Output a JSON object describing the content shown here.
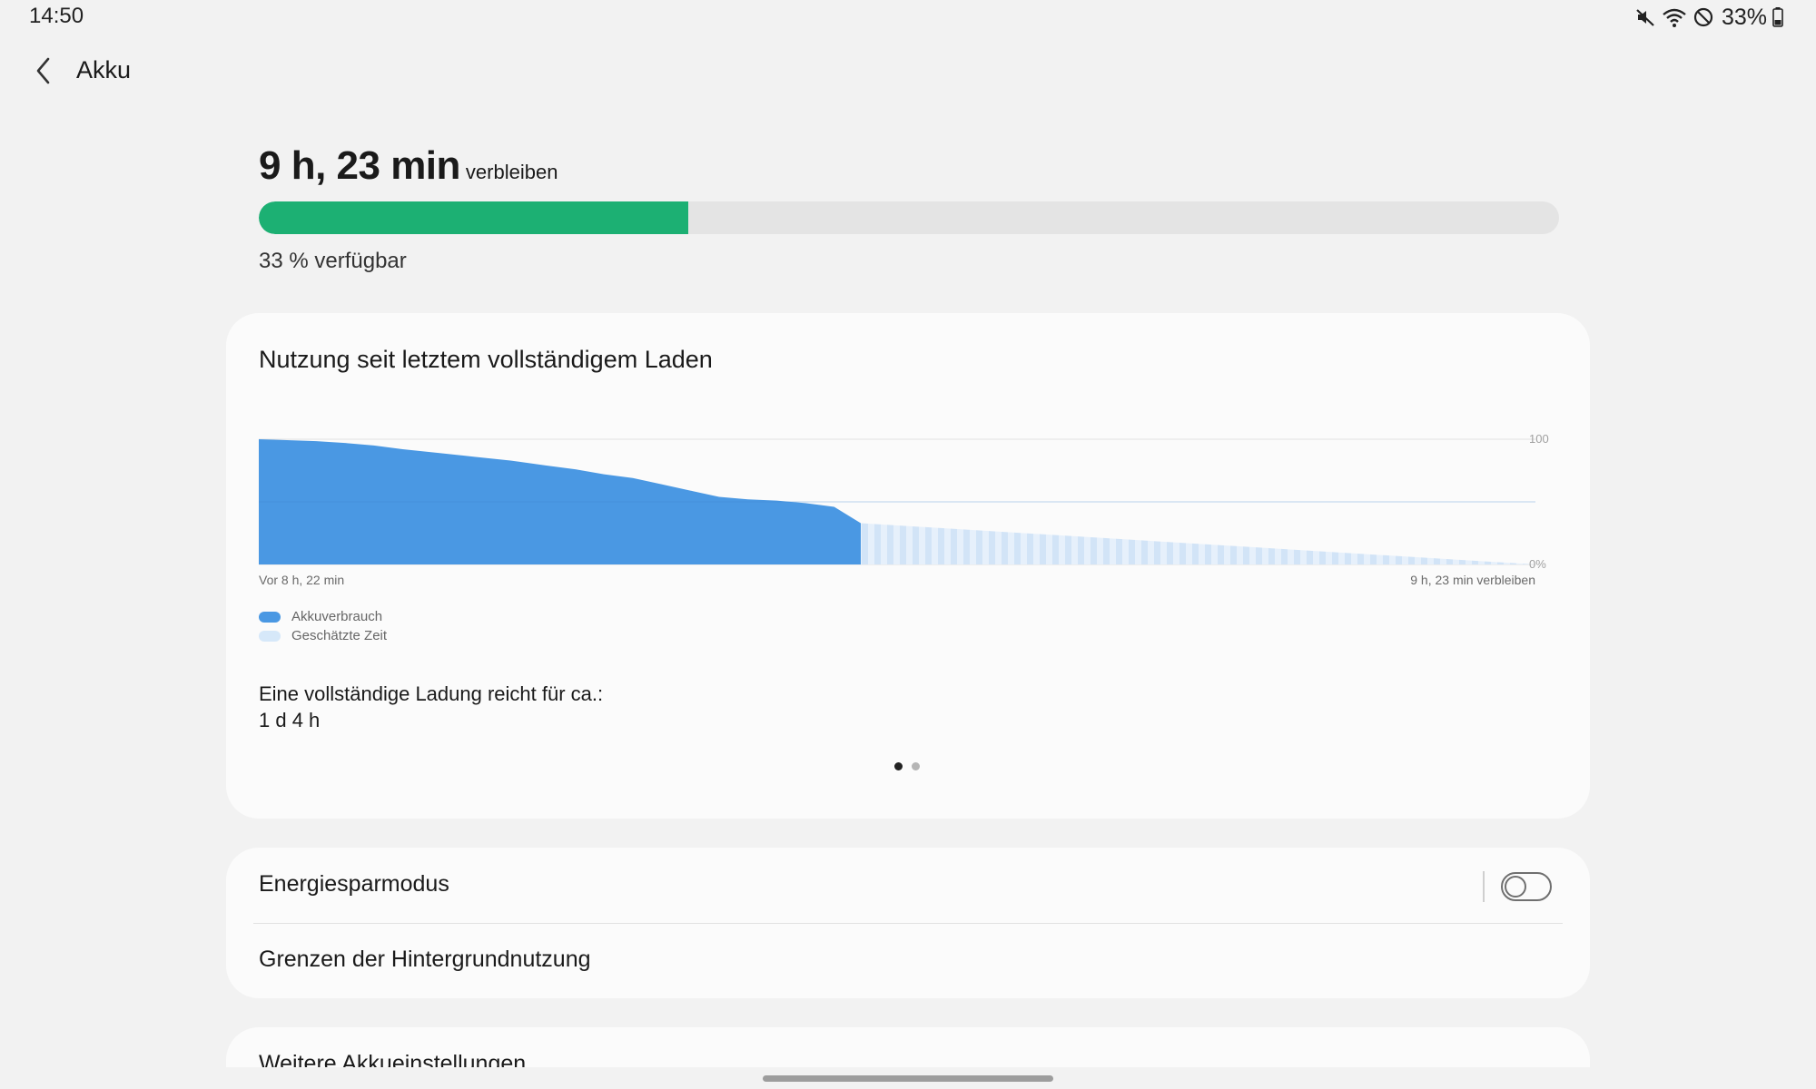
{
  "status_bar": {
    "time": "14:50",
    "battery_percent": "33%",
    "icons": [
      "mute-icon",
      "wifi-icon",
      "do-not-disturb-icon",
      "battery-icon"
    ]
  },
  "app_bar": {
    "back_icon": "chevron-left-icon",
    "title": "Akku"
  },
  "summary": {
    "remaining_time": "9 h, 23 min",
    "remaining_suffix": "verbleiben",
    "battery_level_percent": 33,
    "available_text": "33 % verfügbar",
    "progress_color": "#1cb073"
  },
  "usage_card": {
    "title": "Nutzung seit letztem vollständigem Laden",
    "full_charge_label": "Eine vollständige Ladung reicht für ca.:",
    "full_charge_value": "1 d 4 h",
    "pager": {
      "pages": 2,
      "active": 0
    }
  },
  "chart_data": {
    "type": "area",
    "x_start_label": "Vor 8 h, 22 min",
    "x_end_label": "9 h, 23 min verbleiben",
    "y_tick_labels": [
      "100",
      "0%"
    ],
    "ylim": [
      0,
      100
    ],
    "grid": true,
    "legend_position": "bottom-left",
    "series": [
      {
        "name": "Akkuverbrauch",
        "color": "#4a98e3",
        "x_hours": [
          0,
          0.3,
          0.8,
          1.2,
          1.6,
          2.0,
          2.5,
          3.0,
          3.5,
          4.0,
          4.4,
          4.8,
          5.2,
          5.6,
          6.0,
          6.4,
          6.8,
          7.2,
          7.6,
          8.0,
          8.37
        ],
        "values": [
          100,
          99.5,
          98.5,
          97,
          95,
          92,
          89,
          86,
          83,
          79,
          76,
          72,
          69,
          64,
          59,
          54,
          52,
          51,
          49,
          46,
          33
        ]
      },
      {
        "name": "Geschätzte Zeit",
        "color": "#d6e8f9",
        "x_hours": [
          8.37,
          17.75
        ],
        "values": [
          33,
          0
        ]
      }
    ]
  },
  "settings_card": {
    "power_saving_label": "Energiesparmodus",
    "power_saving_on": false,
    "background_limits_label": "Grenzen der Hintergrundnutzung"
  },
  "more_card": {
    "label": "Weitere Akkueinstellungen"
  }
}
